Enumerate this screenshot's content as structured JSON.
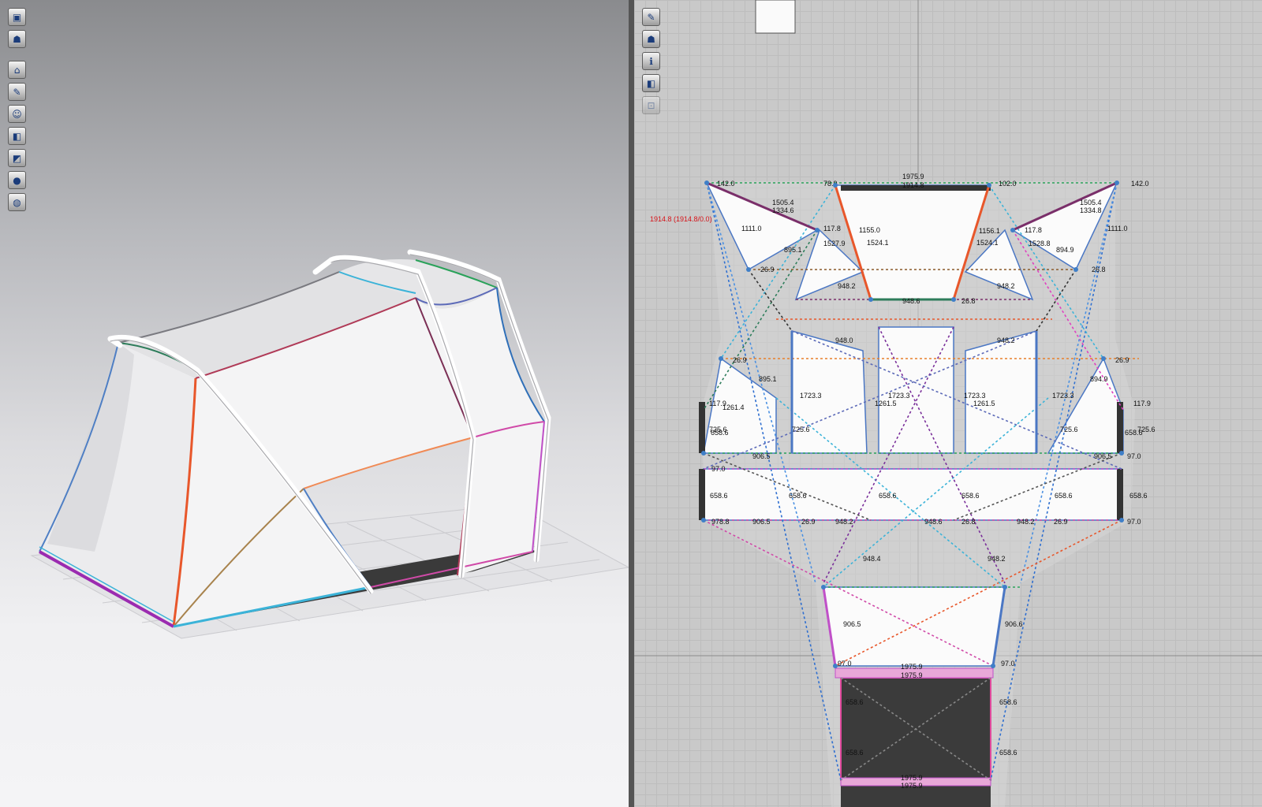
{
  "viewport_3d": {
    "toolbar": [
      {
        "icon": "cube-view-icon"
      },
      {
        "icon": "garment-icon"
      },
      {
        "icon": "home-view-icon"
      },
      {
        "icon": "brush-visibility-icon"
      },
      {
        "icon": "avatar-visibility-icon"
      },
      {
        "icon": "texture-icon"
      },
      {
        "icon": "surface-shading-icon"
      },
      {
        "icon": "avatar-icon"
      },
      {
        "icon": "globe-icon"
      }
    ]
  },
  "viewport_2d": {
    "toolbar": [
      {
        "icon": "pen-visibility-icon"
      },
      {
        "icon": "garment-visibility-icon"
      },
      {
        "icon": "info-icon"
      },
      {
        "icon": "texture-2d-icon"
      },
      {
        "icon": "lock-icon"
      }
    ],
    "selection_readout": "1914.8 (1914.8/0.0)",
    "measurements": {
      "top": [
        "1975.9",
        "1914.8",
        "142.0",
        "142.0",
        "1505.4",
        "1505.4",
        "1111.0",
        "1111.0",
        "1334.6",
        "1334.8",
        "117.8",
        "117.8",
        "1527.9",
        "1528.8",
        "895.1",
        "894.9",
        "1155.0",
        "1156.1",
        "1524.1",
        "1524.1",
        "26.9",
        "26.8",
        "948.2",
        "948.2",
        "948.6",
        "26.8",
        "102.0",
        "78.9"
      ],
      "middle": [
        "1723.3",
        "1723.3",
        "1723.3",
        "1723.3",
        "1261.5",
        "1261.5",
        "1261.4",
        "895.1",
        "894.9",
        "948.0",
        "948.2",
        "26.9",
        "26.9",
        "117.9",
        "117.9",
        "725.6",
        "725.6",
        "725.6",
        "725.6",
        "658.6",
        "658.6",
        "906.5",
        "906.5",
        "97.0",
        "97.0"
      ],
      "lower": [
        "658.6",
        "658.6",
        "658.6",
        "658.6",
        "658.6",
        "658.6",
        "978.8",
        "906.5",
        "948.2",
        "948.2",
        "948.6",
        "26.9",
        "26.8",
        "26.9",
        "97.0",
        "948.4",
        "948.2"
      ],
      "bottom": [
        "906.5",
        "906.6",
        "97.0",
        "97.0",
        "1975.9",
        "1975.9",
        "658.6",
        "658.6",
        "658.6",
        "658.6",
        "1975.9",
        "1975.9"
      ]
    }
  }
}
